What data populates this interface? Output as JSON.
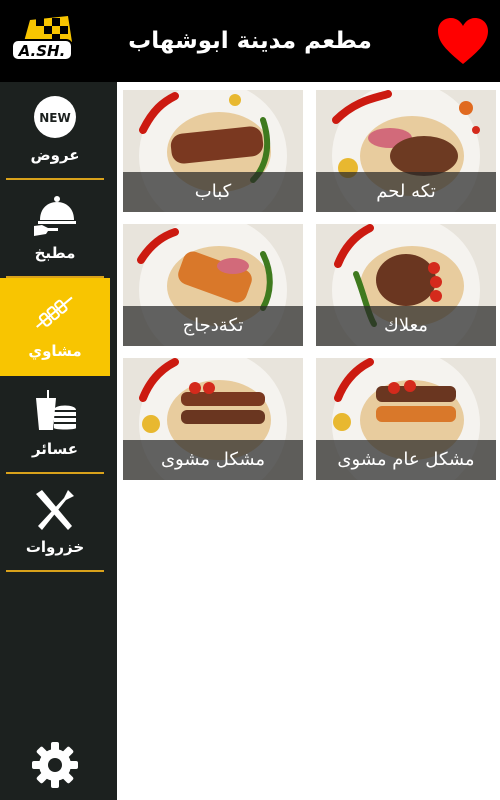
{
  "header": {
    "title": "مطعم مدينة ابوشهاب",
    "logo_text": "A.SH.",
    "heart_color": "#ff0000"
  },
  "sidebar": {
    "items": [
      {
        "label": "عروض",
        "icon": "new-badge-icon",
        "badge": "NEW"
      },
      {
        "label": "مطبخ",
        "icon": "cloche-icon"
      },
      {
        "label": "مشاوي",
        "icon": "grill-skewer-icon",
        "active": true
      },
      {
        "label": "عسائر",
        "icon": "drink-burger-icon"
      },
      {
        "label": "خزروات",
        "icon": "fork-knife-icon"
      }
    ],
    "settings_icon": "gear-icon",
    "active_color": "#f8c501",
    "separator_color": "#d9a21b"
  },
  "menu": {
    "items": [
      {
        "label": "تكه لحم"
      },
      {
        "label": "كباب"
      },
      {
        "label": "معلاك"
      },
      {
        "label": "تكةدجاج"
      },
      {
        "label": "مشكل عام مشوى"
      },
      {
        "label": "مشكل مشوى"
      }
    ]
  }
}
